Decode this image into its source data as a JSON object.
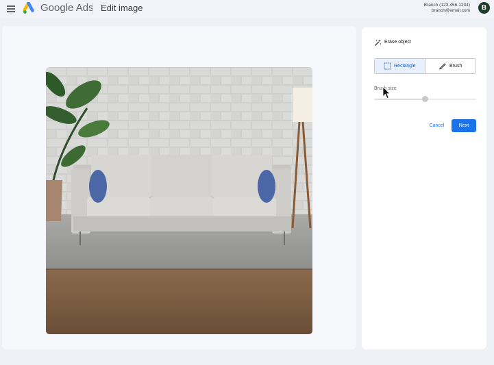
{
  "header": {
    "brand": "Google Ads",
    "page_title": "Edit image",
    "account_name": "Branch (123-456-1234)",
    "account_email": "branch@email.com",
    "avatar_letter": "B"
  },
  "editor": {
    "tool_title": "Erase object",
    "modes": [
      {
        "label": "Rectangle",
        "icon": "rectangle-select-icon",
        "selected": true
      },
      {
        "label": "Brush",
        "icon": "brush-icon",
        "selected": false
      }
    ],
    "brush_size_label": "Brush size",
    "brush_size_fraction": 0.5,
    "cancel_label": "Cancel",
    "next_label": "Next"
  },
  "colors": {
    "accent": "#1a73e8",
    "selected_bg": "#e8f0fe",
    "avatar_bg": "#1e3a2b"
  }
}
